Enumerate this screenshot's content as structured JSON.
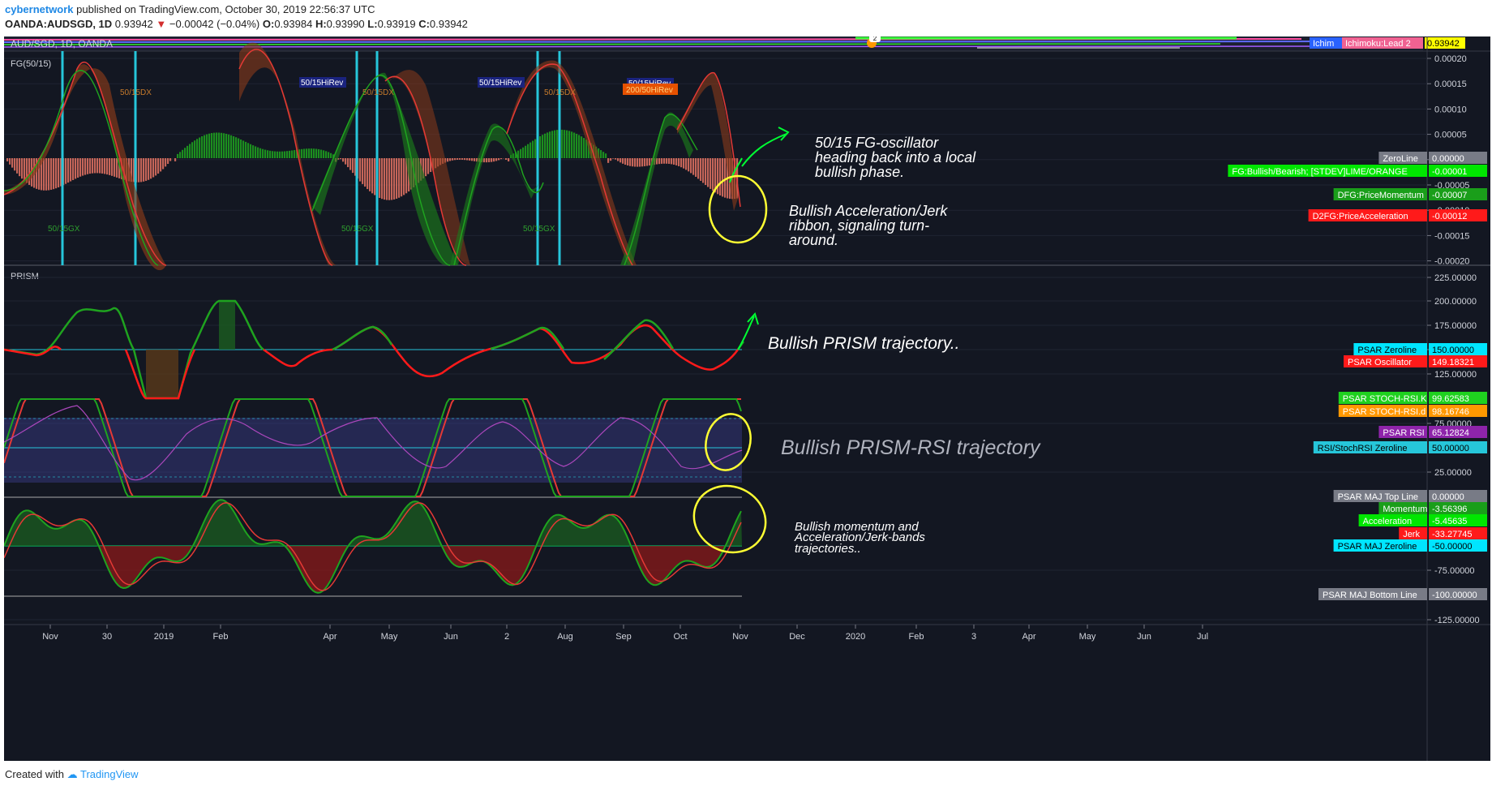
{
  "header": {
    "user": "cybernetwork",
    "published_text": "published on TradingView.com, October 30, 2019 22:56:37 UTC",
    "symbol_line": "OANDA:AUDSGD, 1D",
    "price": "0.93942",
    "change_arrow": "▼",
    "change": "−0.00042 (−0.04%)",
    "open_label": "O:",
    "open": "0.93984",
    "high_label": "H:",
    "high": "0.93990",
    "low_label": "L:",
    "low": "0.93919",
    "close_label": "C:",
    "close": "0.93942"
  },
  "chart": {
    "pair_label": "AUD/SGD, 1D, OANDA",
    "current_price_badge": "0.93942",
    "ichimoku_badge": "Ichimoku:Lead 2",
    "ichimoku_small": "Ichim",
    "counter_badge": "2",
    "panes": {
      "fg": {
        "title": "FG(50/15)",
        "axis_ticks": [
          "0.00020",
          "0.00015",
          "0.00010",
          "0.00005",
          "0.00000",
          "-0.00005",
          "-0.00010",
          "-0.00015",
          "-0.00020"
        ],
        "markers": {
          "x1": "50/15DX",
          "x2": "50/15DX",
          "x3": "50/15DX",
          "hr1": "50/15HiRev",
          "hr2": "50/15HiRev",
          "hr3": "50/15HiRev",
          "hr4": "200/50HiRev",
          "gx1": "50/15GX",
          "gx2": "50/15GX",
          "gx3": "50/15GX"
        },
        "annotation_oscillator": [
          "50/15 FG-oscillator",
          "heading back into a local",
          "bullish phase."
        ],
        "annotation_ribbon": [
          "Bullish Acceleration/Jerk",
          "ribbon, signaling turn-",
          "around."
        ],
        "badges": [
          {
            "label": "ZeroLine",
            "value": "0.00000",
            "color": "#787b86"
          },
          {
            "label": "FG:Bullish/Bearish; [STDEV]LIME/ORANGE",
            "value": "-0.00001",
            "color": "#00e600"
          },
          {
            "label": "DFG:PriceMomentum",
            "value": "-0.00007",
            "color": "#1a9e1a"
          },
          {
            "label": "D2FG:PriceAcceleration",
            "value": "-0.00012",
            "color": "#ff1a1a"
          }
        ]
      },
      "prism": {
        "title": "PRISM",
        "axis_ticks": [
          "225.00000",
          "200.00000",
          "175.00000",
          "150.00000",
          "125.00000",
          "75.00000",
          "25.00000",
          "-75.00000",
          "-125.00000"
        ],
        "annotation_prism": "Bullish PRISM trajectory..",
        "annotation_rsi": "Bullish PRISM-RSI trajectory",
        "annotation_momentum": [
          "Bullish momentum and",
          "Acceleration/Jerk-bands",
          "trajectories.."
        ],
        "badges": [
          {
            "label": "PSAR Zeroline",
            "value": "150.00000",
            "color": "#00e5ff"
          },
          {
            "label": "PSAR Oscillator",
            "value": "149.18321",
            "color": "#ff1a1a"
          },
          {
            "label": "PSAR STOCH-RSI.K",
            "value": "99.62583",
            "color": "#1fd11f"
          },
          {
            "label": "PSAR STOCH-RSI.d",
            "value": "98.16746",
            "color": "#ff9800"
          },
          {
            "label": "PSAR RSI",
            "value": "65.12824",
            "color": "#8e24aa"
          },
          {
            "label": "RSI/StochRSI Zeroline",
            "value": "50.00000",
            "color": "#26c6da"
          },
          {
            "label": "PSAR MAJ Top Line",
            "value": "0.00000",
            "color": "#787b86"
          },
          {
            "label": "Momentum",
            "value": "-3.56396",
            "color": "#1a9e1a"
          },
          {
            "label": "Acceleration",
            "value": "-5.45635",
            "color": "#00e600"
          },
          {
            "label": "Jerk",
            "value": "-33.27745",
            "color": "#ff1a1a"
          },
          {
            "label": "PSAR MAJ Zeroline",
            "value": "-50.00000",
            "color": "#00e5ff"
          },
          {
            "label": "PSAR MAJ Bottom Line",
            "value": "-100.00000",
            "color": "#787b86"
          }
        ]
      }
    },
    "time_axis": [
      "Nov",
      "30",
      "2019",
      "Feb",
      "Apr",
      "May",
      "Jun",
      "2",
      "Aug",
      "Sep",
      "Oct",
      "Nov",
      "Dec",
      "2020",
      "Feb",
      "3",
      "Apr",
      "May",
      "Jun",
      "Jul"
    ]
  },
  "footer": {
    "created_with": "Created with",
    "brand": "TradingView"
  },
  "colors": {
    "background": "#131722",
    "bull": "#1fa31f",
    "bear": "#e53935",
    "annotation": "#ffff33",
    "arrow": "#00ff33",
    "zero_line_cyan": "#26c6da"
  }
}
